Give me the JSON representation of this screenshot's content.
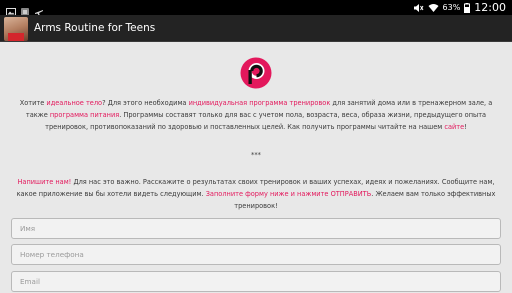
{
  "status_bar": {
    "battery_percent": "63%",
    "time": "12:00",
    "icons": [
      "image-icon",
      "app-notification-icon",
      "airplane-icon",
      "mute-icon",
      "wifi-icon",
      "battery-icon"
    ]
  },
  "action_bar": {
    "title": "Arms Routine for Teens",
    "icon": "app-icon"
  },
  "logo": {
    "icon": "p-logo-icon",
    "color": "#e3185c"
  },
  "intro": {
    "s1": "Хотите ",
    "h1": "идеальное тело",
    "s2": "? Для этого необходима ",
    "h2": "индивидуальная программа тренировок",
    "s3": " для занятий дома или в тренажерном зале, а также ",
    "h3": "программа питания",
    "s4": ". Программы составят только для вас с учетом пола, возраста, веса, образа жизни, предыдущего опыта тренировок, противопоказаний по здоровью и поставленных целей. Как получить программы читайте на нашем ",
    "h4": "сайте",
    "s5": "!"
  },
  "separator": "***",
  "contact": {
    "h1": "Напишите нам!",
    "s1": " Для нас это важно. Расскажите о результатах своих тренировок и ваших успехах, идеях и пожеланиях. Сообщите нам, какое приложение вы бы хотели видеть следующим. ",
    "h2": "Заполните форму ниже и нажмите ОТПРАВИТЬ",
    "s2": ". Желаем вам только эффективных тренировок!"
  },
  "form": {
    "name_placeholder": "Имя",
    "phone_placeholder": "Номер телефона",
    "email_placeholder": "Email"
  },
  "colors": {
    "accent": "#e3185c",
    "status_bar": "#000000",
    "action_bar": "#232323",
    "background": "#e8e8e8"
  }
}
